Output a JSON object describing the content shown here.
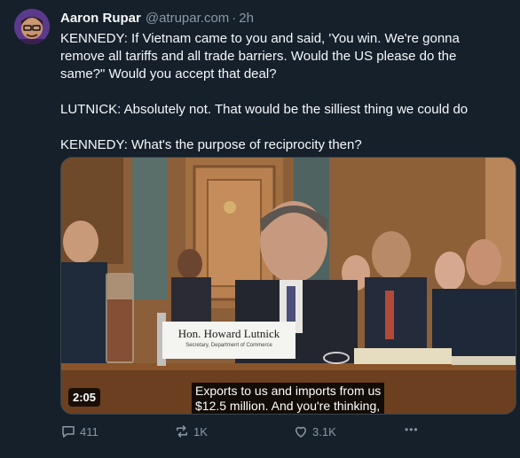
{
  "post": {
    "author_name": "Aaron Rupar",
    "handle": "@atrupar.com",
    "separator": "·",
    "time": "2h",
    "text": [
      "KENNEDY: If Vietnam came to you and said, 'You win. We're gonna remove all tariffs and all trade barriers. Would the US please do the same?\" Would you accept that deal?",
      "LUTNICK: Absolutely not. That would be the silliest thing we could do",
      "KENNEDY: What's the purpose of reciprocity then?"
    ]
  },
  "video": {
    "duration": "2:05",
    "caption_line1": "Exports to us and imports from us",
    "caption_line2": "$12.5 million. And you're thinking,",
    "nameplate_name": "Hon. Howard Lutnick",
    "nameplate_title": "Secretary, Department of Commerce"
  },
  "actions": {
    "replies": "411",
    "reposts": "1K",
    "likes": "3.1K",
    "more": "•••"
  },
  "colors": {
    "background": "#15202b",
    "text": "#f7f9f9",
    "muted": "#8b98a5"
  }
}
